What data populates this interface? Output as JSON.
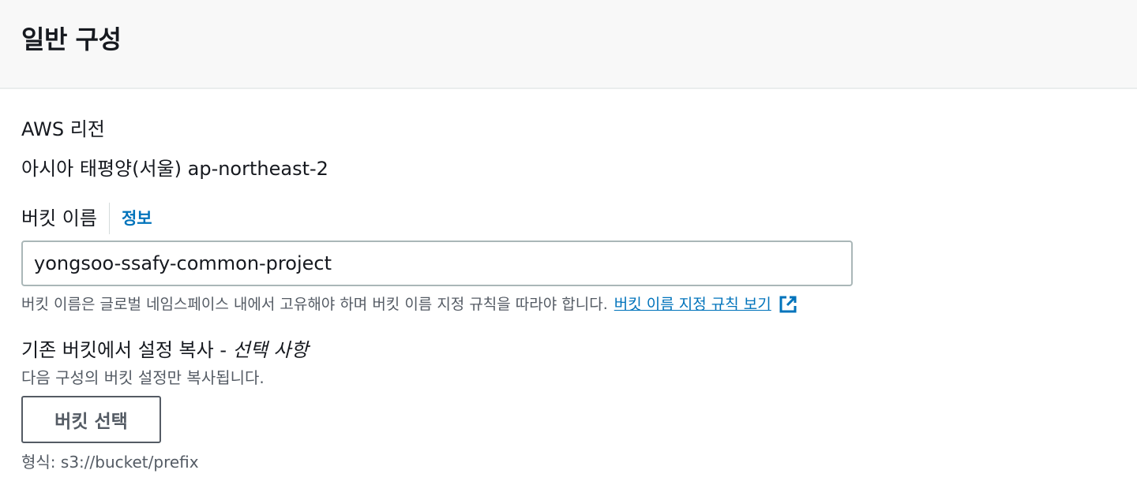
{
  "panel": {
    "title": "일반 구성"
  },
  "region": {
    "label": "AWS 리전",
    "value": "아시아 태평양(서울) ap-northeast-2"
  },
  "bucket_name": {
    "label": "버킷 이름",
    "info_link": "정보",
    "value": "yongsoo-ssafy-common-project",
    "hint": "버킷 이름은 글로벌 네임스페이스 내에서 고유해야 하며 버킷 이름 지정 규칙을 따라야 합니다.",
    "rules_link": "버킷 이름 지정 규칙 보기",
    "rules_link_icon": "external-link-icon"
  },
  "copy_settings": {
    "label": "기존 버킷에서 설정 복사 - ",
    "optional": "선택 사항",
    "description": "다음 구성의 버킷 설정만 복사됩니다.",
    "button_label": "버킷 선택",
    "format_hint": "형식: s3://bucket/prefix"
  },
  "colors": {
    "link": "#0073bb",
    "header_bg": "#f8f8f8",
    "text": "#16191f",
    "secondary_text": "#545b64"
  }
}
